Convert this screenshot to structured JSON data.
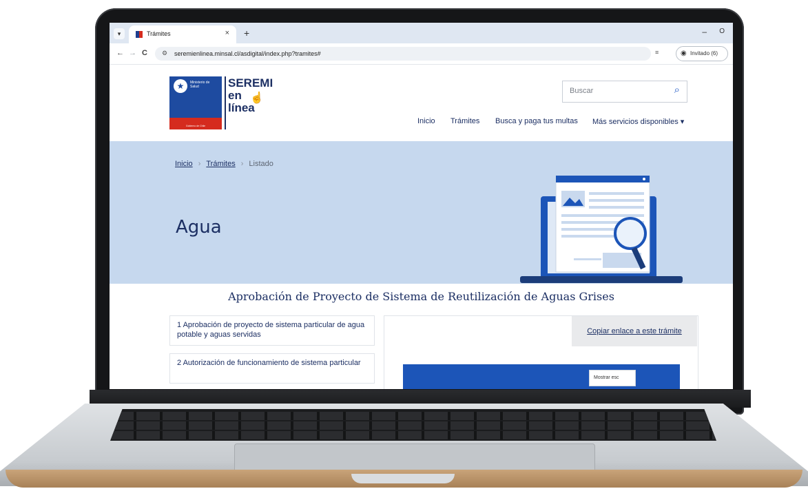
{
  "browser": {
    "tab_title": "Trámites",
    "tab_close": "×",
    "new_tab": "+",
    "url": "seremienlinea.minsal.cl/asdigital/index.php?tramites#",
    "profile_label": "Invitado (6)",
    "back": "←",
    "forward": "→",
    "reload": "C",
    "minimize": "–",
    "restore": "O"
  },
  "header": {
    "gov_line1": "Ministerio de",
    "gov_line2": "Salud",
    "gov_footer": "Gobierno de Chile",
    "brand_line1": "SEREMI",
    "brand_line2": "en",
    "brand_line3": "línea",
    "search_placeholder": "Buscar",
    "nav": [
      "Inicio",
      "Trámites",
      "Busca y paga tus multas",
      "Más servicios disponibles ▾"
    ]
  },
  "hero": {
    "breadcrumb": [
      "Inicio",
      "Trámites",
      "Listado"
    ],
    "breadcrumb_sep": "›",
    "title": "Agua"
  },
  "content": {
    "title": "Aprobación de Proyecto de Sistema de Reutilización de Aguas Grises",
    "steps": [
      "1 Aprobación de proyecto de sistema particular de agua potable y aguas servidas",
      "2 Autorización de funcionamiento de sistema particular"
    ],
    "copy_link": "Copiar enlace a este trámite",
    "show_button": "Mostrar esc"
  },
  "colors": {
    "brand_navy": "#1c2f63",
    "hero_bg": "#c6d8ee",
    "accent_blue": "#1c55b8",
    "gov_red": "#d52b1e"
  }
}
